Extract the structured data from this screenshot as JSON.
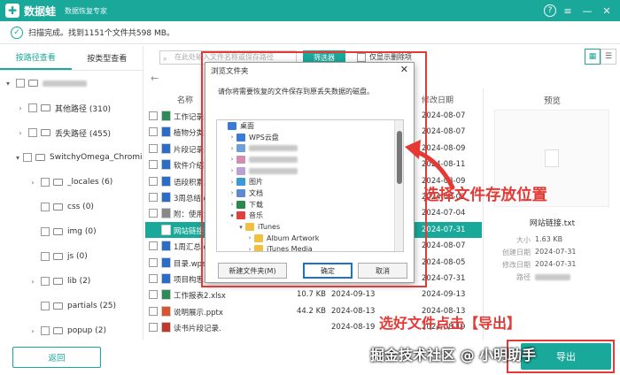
{
  "app": {
    "logo": "✚",
    "name": "数据蛙",
    "subtitle": "数据恢复专家"
  },
  "window": {
    "help": "?",
    "menu": "≡",
    "min": "—",
    "close": "✕"
  },
  "status": {
    "text": "扫描完成。找到1151个文件共598 MB。"
  },
  "left_tabs": [
    {
      "label": "按路径查看",
      "active": true
    },
    {
      "label": "按类型查看",
      "active": false
    }
  ],
  "tree": [
    {
      "label": "",
      "blurred": true,
      "indent": 0,
      "arrow": "▾"
    },
    {
      "label": "其他路径 (310)",
      "indent": 1,
      "arrow": "›"
    },
    {
      "label": "丢失路径 (455)",
      "indent": 1,
      "arrow": "›"
    },
    {
      "label": "SwitchyOmega_Chromium",
      "indent": 1,
      "arrow": "▾"
    },
    {
      "label": "_locales (6)",
      "indent": 2,
      "arrow": "›"
    },
    {
      "label": "css (0)",
      "indent": 2,
      "arrow": ""
    },
    {
      "label": "img (0)",
      "indent": 2,
      "arrow": ""
    },
    {
      "label": "js (0)",
      "indent": 2,
      "arrow": ""
    },
    {
      "label": "lib (2)",
      "indent": 2,
      "arrow": "›"
    },
    {
      "label": "partials (25)",
      "indent": 2,
      "arrow": ""
    },
    {
      "label": "popup (2)",
      "indent": 2,
      "arrow": "›"
    }
  ],
  "toolbar": {
    "search_placeholder": "在此处输入文件名称或保存路径",
    "filter": "筛选器",
    "only_deleted": "仅显示删除项"
  },
  "list_header": {
    "name": "名称",
    "modified": "修改日期"
  },
  "files": [
    {
      "name": "工作记录.",
      "size": "",
      "created": "",
      "modified": "2024-08-07",
      "type": "xls",
      "color": "#2e8b57",
      "selected": false
    },
    {
      "name": "植物分类.",
      "size": "",
      "created": "",
      "modified": "2024-08-07",
      "type": "doc",
      "color": "#2b6cc4",
      "selected": false
    },
    {
      "name": "片段记录.",
      "size": "",
      "created": "",
      "modified": "2024-08-09",
      "type": "doc",
      "color": "#2b6cc4",
      "selected": false
    },
    {
      "name": "软件介绍",
      "size": "",
      "created": "",
      "modified": "2024-08-11",
      "type": "doc",
      "color": "#2b6cc4",
      "selected": false
    },
    {
      "name": "语段积累.",
      "size": "",
      "created": "",
      "modified": "2024-08-09",
      "type": "doc",
      "color": "#2b6cc4",
      "selected": false
    },
    {
      "name": "3周总结.d",
      "size": "",
      "created": "",
      "modified": "2024-08-02",
      "type": "doc",
      "color": "#2b6cc4",
      "selected": false
    },
    {
      "name": "附：使用注",
      "size": "",
      "created": "",
      "modified": "2024-07-04",
      "type": "txt",
      "color": "#888888",
      "selected": false
    },
    {
      "name": "网站链接.t",
      "size": "",
      "created": "",
      "modified": "2024-07-31",
      "type": "txt",
      "color": "#ffffff",
      "selected": true
    },
    {
      "name": "1周汇总.d",
      "size": "",
      "created": "",
      "modified": "2024-08-07",
      "type": "doc",
      "color": "#2b6cc4",
      "selected": false
    },
    {
      "name": "目录.wps",
      "size": "",
      "created": "",
      "modified": "2024-08-05",
      "type": "wps",
      "color": "#2b6cc4",
      "selected": false
    },
    {
      "name": "项目构思.docx",
      "size": "",
      "created": "",
      "modified": "2024-07-31",
      "type": "doc",
      "color": "#2b6cc4",
      "selected": false
    },
    {
      "name": "工作报表2.xlsx",
      "size": "10.7 KB",
      "created": "2024-09-13",
      "modified": "2024-09-13",
      "type": "xls",
      "color": "#2e8b57",
      "selected": false
    },
    {
      "name": "说明展示.pptx",
      "size": "44.2 KB",
      "created": "2024-08-13",
      "modified": "2024-08-13",
      "type": "ppt",
      "color": "#d9532c",
      "selected": false
    },
    {
      "name": "读书片段记录.",
      "size": "",
      "created": "2024-08-19",
      "modified": "2024-08-19",
      "type": "doc",
      "color": "#c0392b",
      "selected": false
    }
  ],
  "preview": {
    "title": "预览",
    "filename": "网站链接.txt",
    "size_label": "大小",
    "size": "1.63 KB",
    "created_label": "创建日期",
    "created": "2024-07-31",
    "modified_label": "修改日期",
    "modified": "2024-07-31",
    "path_label": "路径"
  },
  "buttons": {
    "back": "返回",
    "export": "导出"
  },
  "dialog": {
    "title": "浏览文件夹",
    "close": "✕",
    "message": "请你将需要恢复的文件保存到原丢失数据的磁盘。",
    "tree": [
      {
        "label": "桌面",
        "indent": 0,
        "arrow": "",
        "color": "#3a7bd5"
      },
      {
        "label": "WPS云盘",
        "indent": 1,
        "arrow": "›",
        "color": "#3a7bd5"
      },
      {
        "label": "",
        "blurred": true,
        "indent": 1,
        "arrow": "›",
        "color": "#6fa0d8"
      },
      {
        "label": "",
        "blurred": true,
        "indent": 1,
        "arrow": "›",
        "color": "#d18fb0"
      },
      {
        "label": "",
        "blurred": true,
        "indent": 1,
        "arrow": "›",
        "color": "#b8a0d8"
      },
      {
        "label": "图片",
        "indent": 1,
        "arrow": "›",
        "color": "#3a9ad5"
      },
      {
        "label": "文档",
        "indent": 1,
        "arrow": "›",
        "color": "#5d8ad0"
      },
      {
        "label": "下载",
        "indent": 1,
        "arrow": "›",
        "color": "#2a8a4a"
      },
      {
        "label": "音乐",
        "indent": 1,
        "arrow": "▾",
        "color": "#e04040"
      },
      {
        "label": "iTunes",
        "indent": 2,
        "arrow": "▾",
        "color": "#f0c040"
      },
      {
        "label": "Album Artwork",
        "indent": 3,
        "arrow": "›",
        "color": "#f0c040"
      },
      {
        "label": "iTunes Media",
        "indent": 3,
        "arrow": "›",
        "color": "#f0c040"
      }
    ],
    "new_folder": "新建文件夹(M)",
    "ok": "确定",
    "cancel": "取消"
  },
  "annotations": {
    "choose_location": "选择文件存放位置",
    "click_export": "选好文件点击【导出】",
    "watermark": "掘金技术社区 @ 小明助手"
  }
}
